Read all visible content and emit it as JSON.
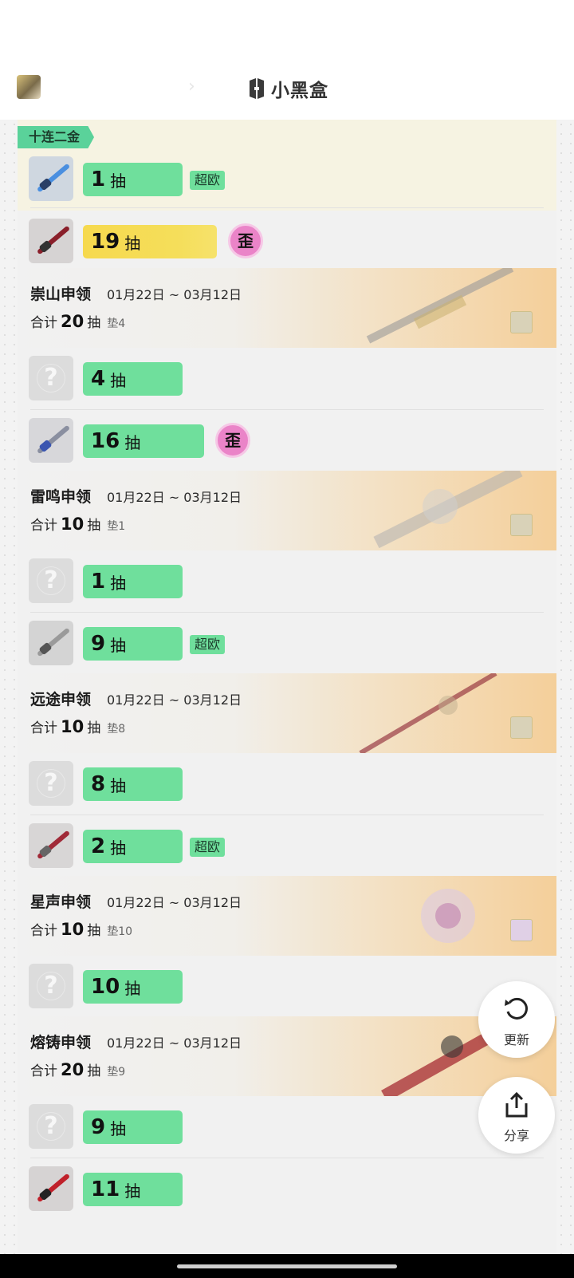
{
  "header": {
    "brand": "小黑盒"
  },
  "top_section": {
    "tag": "十连二金",
    "rows": [
      {
        "pulls": "1",
        "unit": "抽",
        "badge": "超欧"
      },
      {
        "pulls": "19",
        "unit": "抽",
        "badge": "歪"
      }
    ]
  },
  "banners": [
    {
      "name": "崇山申领",
      "date": "01月22日 ~ 03月12日",
      "total_label": "合计",
      "total": "20",
      "unit": "抽",
      "pity": "垫4",
      "rows": [
        {
          "pulls": "4",
          "unit": "抽"
        },
        {
          "pulls": "16",
          "unit": "抽",
          "badge": "歪"
        }
      ]
    },
    {
      "name": "雷鸣申领",
      "date": "01月22日 ~ 03月12日",
      "total_label": "合计",
      "total": "10",
      "unit": "抽",
      "pity": "垫1",
      "rows": [
        {
          "pulls": "1",
          "unit": "抽"
        },
        {
          "pulls": "9",
          "unit": "抽",
          "badge": "超欧"
        }
      ]
    },
    {
      "name": "远途申领",
      "date": "01月22日 ~ 03月12日",
      "total_label": "合计",
      "total": "10",
      "unit": "抽",
      "pity": "垫8",
      "rows": [
        {
          "pulls": "8",
          "unit": "抽"
        },
        {
          "pulls": "2",
          "unit": "抽",
          "badge": "超欧"
        }
      ]
    },
    {
      "name": "星声申领",
      "date": "01月22日 ~ 03月12日",
      "total_label": "合计",
      "total": "10",
      "unit": "抽",
      "pity": "垫10",
      "rows": [
        {
          "pulls": "10",
          "unit": "抽"
        }
      ]
    },
    {
      "name": "熔铸申领",
      "date": "01月22日 ~ 03月12日",
      "total_label": "合计",
      "total": "20",
      "unit": "抽",
      "pity": "垫9",
      "rows": [
        {
          "pulls": "9",
          "unit": "抽"
        },
        {
          "pulls": "11",
          "unit": "抽"
        }
      ]
    }
  ],
  "unknown_symbol": "?",
  "fabs": {
    "refresh": "更新",
    "share": "分享"
  },
  "colors": {
    "green": "#6fdf9c",
    "yellow": "#f6d94e",
    "pink": "#ea84c8"
  }
}
